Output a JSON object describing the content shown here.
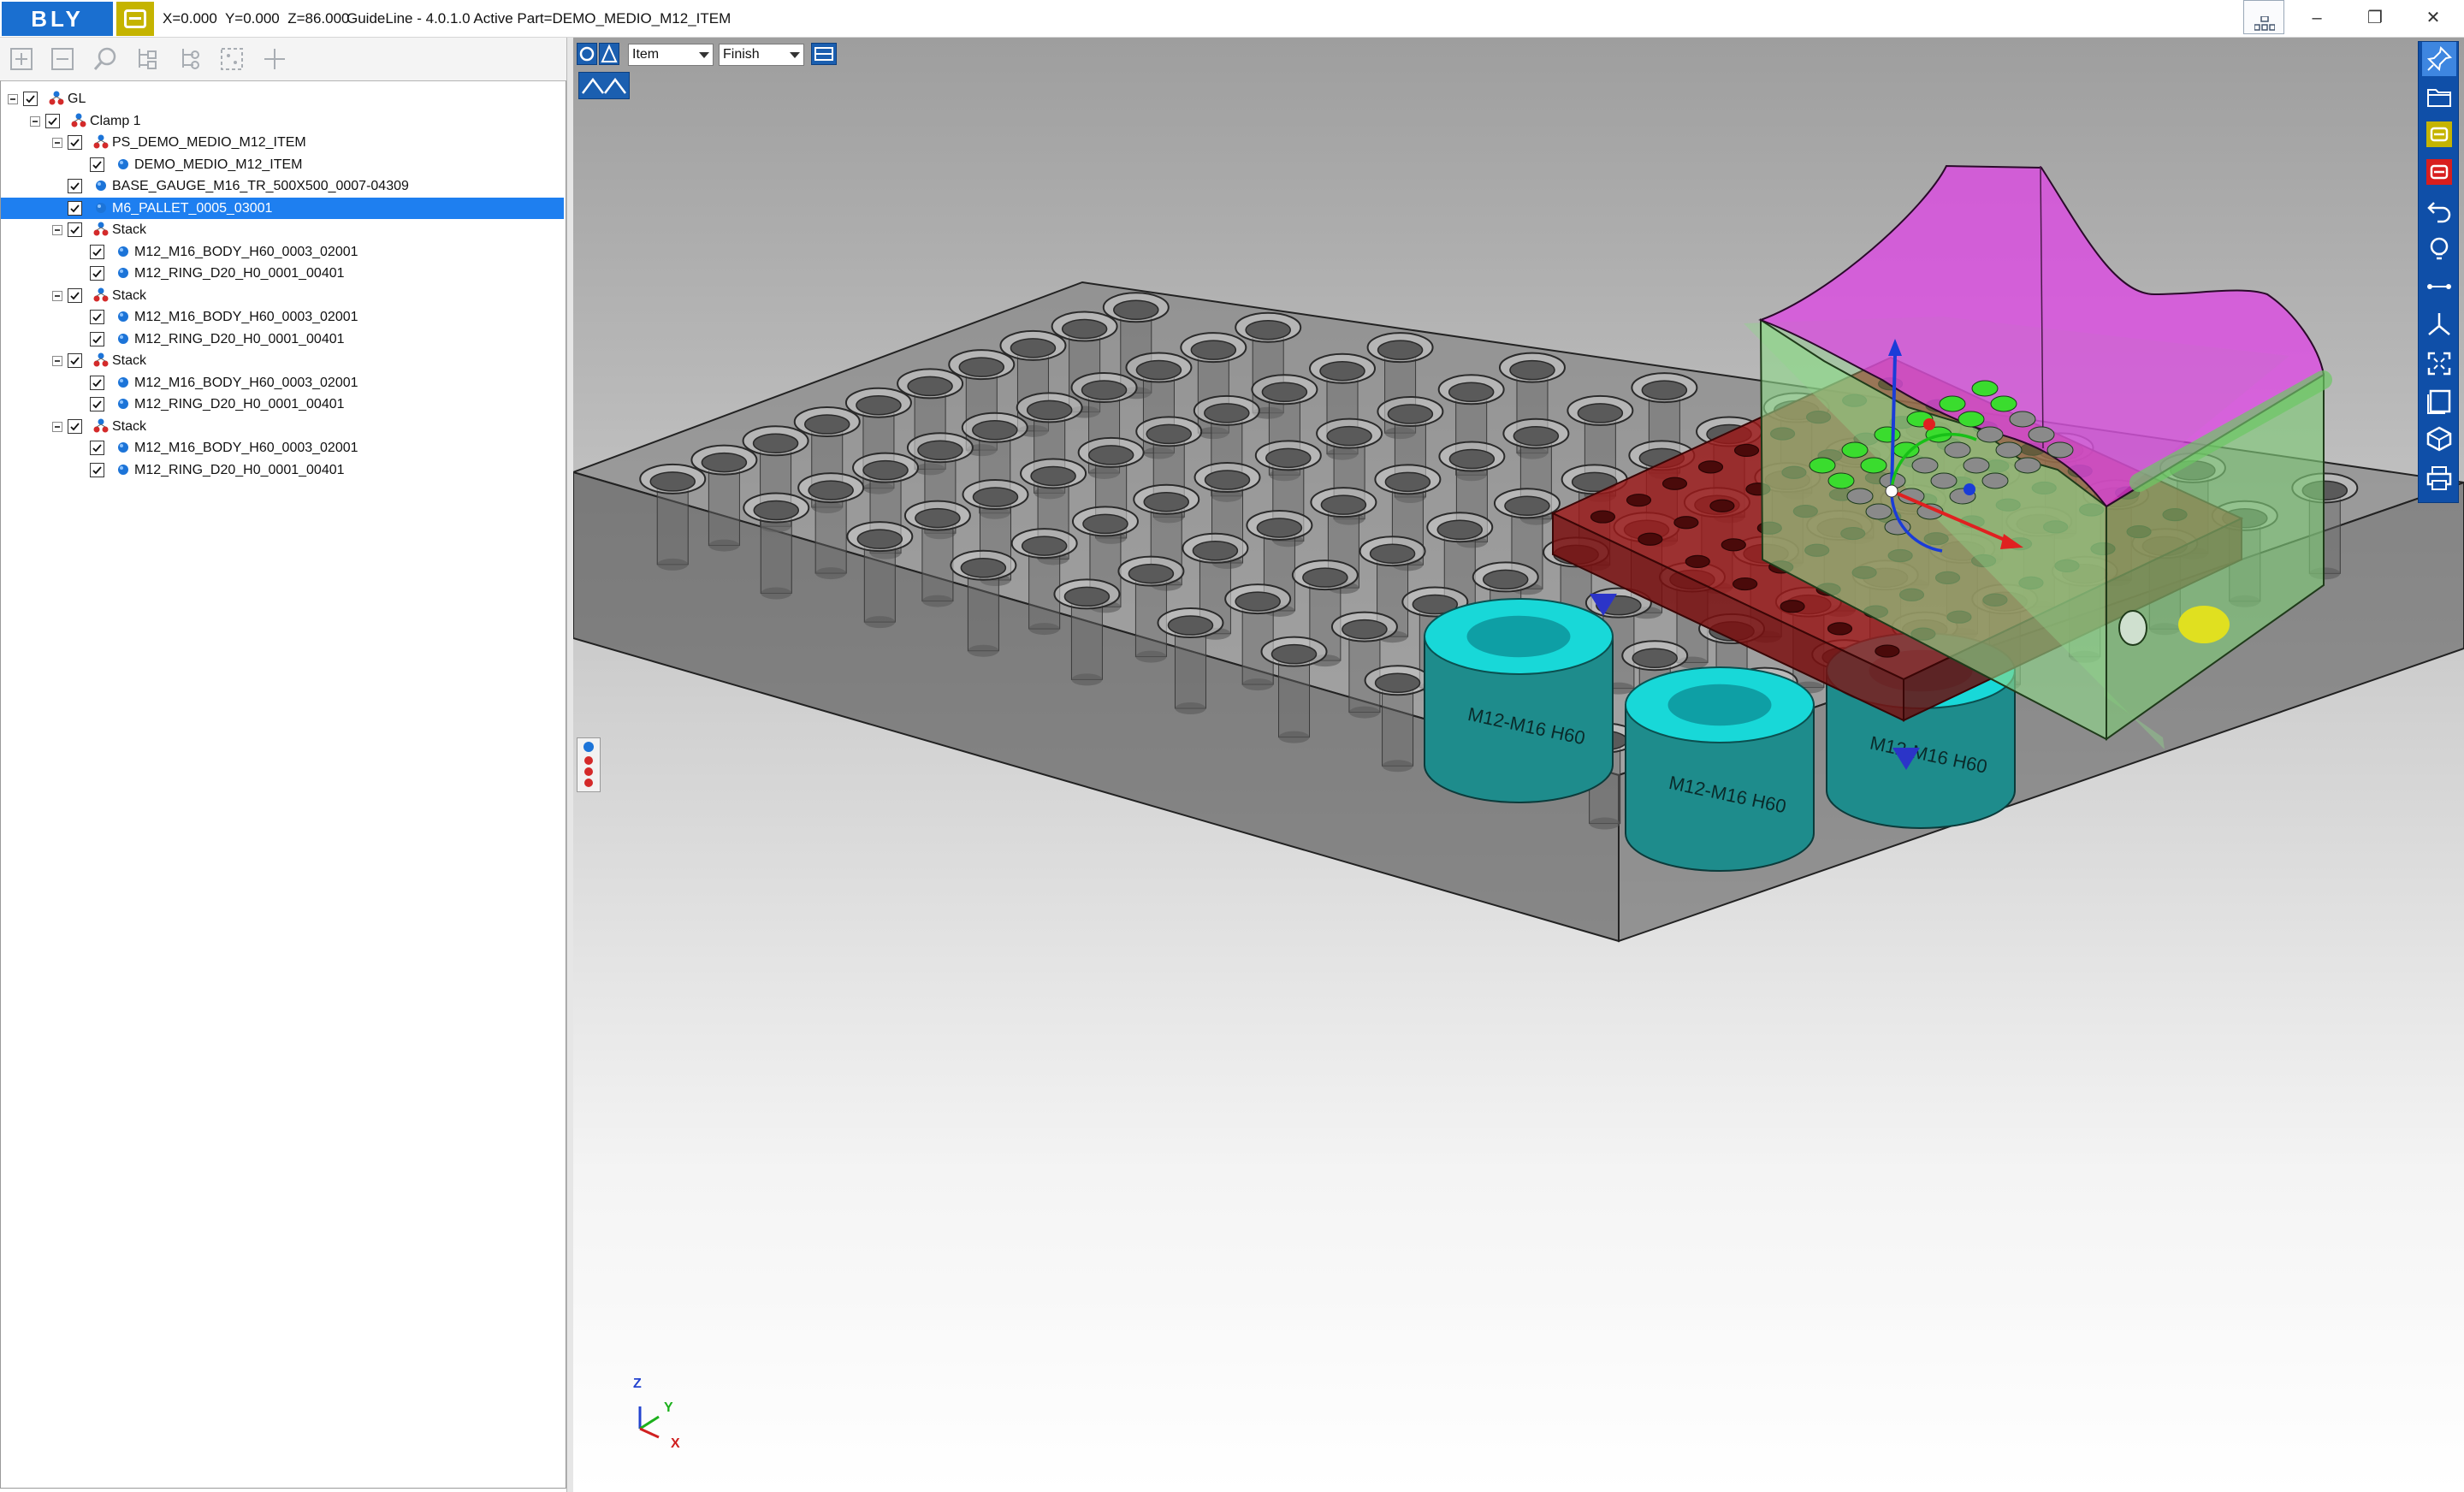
{
  "titlebar": {
    "logo_text": "BLY",
    "coordinates": "X=0.000  Y=0.000  Z=86.000",
    "title": "GuideLine - 4.0.1.0 Active Part=DEMO_MEDIO_M12_ITEM",
    "window_controls": {
      "minimize": "–",
      "restore": "❐",
      "close": "✕"
    }
  },
  "tree_toolbar": {
    "icons": [
      "expand-all-icon",
      "collapse-all-icon",
      "find-icon",
      "tree-view-icon",
      "tree-branch-icon",
      "select-frame-icon",
      "add-icon"
    ]
  },
  "tree": {
    "items": [
      {
        "label": "GL",
        "level": 0,
        "icon": "assembly-icon",
        "expandable": true,
        "checked": true,
        "selected": false
      },
      {
        "label": "Clamp 1",
        "level": 1,
        "icon": "assembly-icon",
        "expandable": true,
        "checked": true,
        "selected": false
      },
      {
        "label": "PS_DEMO_MEDIO_M12_ITEM",
        "level": 2,
        "icon": "assembly-icon",
        "expandable": true,
        "checked": true,
        "selected": false
      },
      {
        "label": "DEMO_MEDIO_M12_ITEM",
        "level": 3,
        "icon": "part-icon",
        "expandable": false,
        "checked": true,
        "selected": false
      },
      {
        "label": "BASE_GAUGE_M16_TR_500X500_0007-04309",
        "level": 2,
        "icon": "part-icon",
        "expandable": false,
        "checked": true,
        "selected": false
      },
      {
        "label": "M6_PALLET_0005_03001",
        "level": 2,
        "icon": "part-icon",
        "expandable": false,
        "checked": true,
        "selected": true
      },
      {
        "label": "Stack",
        "level": 2,
        "icon": "assembly-icon",
        "expandable": true,
        "checked": true,
        "selected": false
      },
      {
        "label": "M12_M16_BODY_H60_0003_02001",
        "level": 3,
        "icon": "part-icon",
        "expandable": false,
        "checked": true,
        "selected": false
      },
      {
        "label": "M12_RING_D20_H0_0001_00401",
        "level": 3,
        "icon": "part-icon",
        "expandable": false,
        "checked": true,
        "selected": false
      },
      {
        "label": "Stack",
        "level": 2,
        "icon": "assembly-icon",
        "expandable": true,
        "checked": true,
        "selected": false
      },
      {
        "label": "M12_M16_BODY_H60_0003_02001",
        "level": 3,
        "icon": "part-icon",
        "expandable": false,
        "checked": true,
        "selected": false
      },
      {
        "label": "M12_RING_D20_H0_0001_00401",
        "level": 3,
        "icon": "part-icon",
        "expandable": false,
        "checked": true,
        "selected": false
      },
      {
        "label": "Stack",
        "level": 2,
        "icon": "assembly-icon",
        "expandable": true,
        "checked": true,
        "selected": false
      },
      {
        "label": "M12_M16_BODY_H60_0003_02001",
        "level": 3,
        "icon": "part-icon",
        "expandable": false,
        "checked": true,
        "selected": false
      },
      {
        "label": "M12_RING_D20_H0_0001_00401",
        "level": 3,
        "icon": "part-icon",
        "expandable": false,
        "checked": true,
        "selected": false
      },
      {
        "label": "Stack",
        "level": 2,
        "icon": "assembly-icon",
        "expandable": true,
        "checked": true,
        "selected": false
      },
      {
        "label": "M12_M16_BODY_H60_0003_02001",
        "level": 3,
        "icon": "part-icon",
        "expandable": false,
        "checked": true,
        "selected": false
      },
      {
        "label": "M12_RING_D20_H0_0001_00401",
        "level": 3,
        "icon": "part-icon",
        "expandable": false,
        "checked": true,
        "selected": false
      }
    ]
  },
  "viewport": {
    "filter_combo": {
      "value": "Item"
    },
    "stage_combo": {
      "value": "Finish"
    },
    "body_label": "M12-M16 H60",
    "axis_labels": {
      "z": "Z",
      "y": "Y",
      "x": "X"
    },
    "colors": {
      "workpiece": "#e040e8",
      "transparent_body": "#8fd88a",
      "pallet": "#9c1a1a",
      "stack_body": "#1e8c8c",
      "stack_ring": "#18d8d8",
      "base_plate": "#5e5e5e",
      "selection": "#1e7ff0"
    }
  },
  "right_toolbar": {
    "icons": [
      "pin-icon",
      "open-folder-icon",
      "yellow-b-icon",
      "red-b-icon",
      "undo-icon",
      "lightbulb-icon",
      "measure-icon",
      "axis-icon",
      "fit-view-icon",
      "window-icon",
      "view-cube-icon",
      "print-icon"
    ]
  }
}
